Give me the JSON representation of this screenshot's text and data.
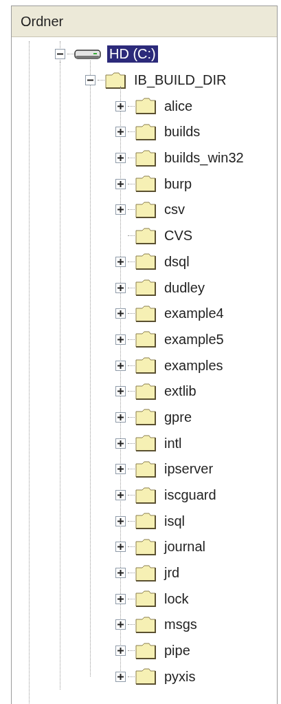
{
  "panel": {
    "title": "Ordner"
  },
  "tree": [
    {
      "label": "HD (C:)",
      "kind": "drive",
      "expanded": true,
      "selected": true,
      "children": [
        {
          "label": "IB_BUILD_DIR",
          "kind": "folder",
          "expanded": true,
          "selected": false,
          "children": [
            {
              "label": "alice",
              "kind": "folder",
              "expanded": false,
              "selected": false
            },
            {
              "label": "builds",
              "kind": "folder",
              "expanded": false,
              "selected": false
            },
            {
              "label": "builds_win32",
              "kind": "folder",
              "expanded": false,
              "selected": false
            },
            {
              "label": "burp",
              "kind": "folder",
              "expanded": false,
              "selected": false
            },
            {
              "label": "csv",
              "kind": "folder",
              "expanded": false,
              "selected": false
            },
            {
              "label": "CVS",
              "kind": "leaf",
              "selected": false
            },
            {
              "label": "dsql",
              "kind": "folder",
              "expanded": false,
              "selected": false
            },
            {
              "label": "dudley",
              "kind": "folder",
              "expanded": false,
              "selected": false
            },
            {
              "label": "example4",
              "kind": "folder",
              "expanded": false,
              "selected": false
            },
            {
              "label": "example5",
              "kind": "folder",
              "expanded": false,
              "selected": false
            },
            {
              "label": "examples",
              "kind": "folder",
              "expanded": false,
              "selected": false
            },
            {
              "label": "extlib",
              "kind": "folder",
              "expanded": false,
              "selected": false
            },
            {
              "label": "gpre",
              "kind": "folder",
              "expanded": false,
              "selected": false
            },
            {
              "label": "intl",
              "kind": "folder",
              "expanded": false,
              "selected": false
            },
            {
              "label": "ipserver",
              "kind": "folder",
              "expanded": false,
              "selected": false
            },
            {
              "label": "iscguard",
              "kind": "folder",
              "expanded": false,
              "selected": false
            },
            {
              "label": "isql",
              "kind": "folder",
              "expanded": false,
              "selected": false
            },
            {
              "label": "journal",
              "kind": "folder",
              "expanded": false,
              "selected": false
            },
            {
              "label": "jrd",
              "kind": "folder",
              "expanded": false,
              "selected": false
            },
            {
              "label": "lock",
              "kind": "folder",
              "expanded": false,
              "selected": false
            },
            {
              "label": "msgs",
              "kind": "folder",
              "expanded": false,
              "selected": false
            },
            {
              "label": "pipe",
              "kind": "folder",
              "expanded": false,
              "selected": false
            },
            {
              "label": "pyxis",
              "kind": "folder",
              "expanded": false,
              "selected": false
            }
          ]
        }
      ]
    }
  ]
}
